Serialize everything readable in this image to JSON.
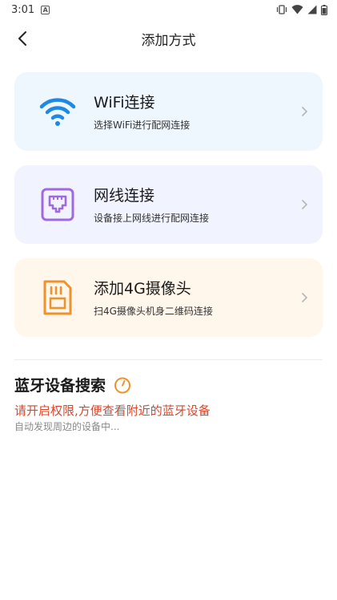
{
  "status_bar": {
    "time": "3:01",
    "notification_icon": "a-badge-icon",
    "icons": [
      "vibrate-icon",
      "wifi-signal-icon",
      "cell-signal-icon",
      "battery-icon"
    ]
  },
  "header": {
    "title": "添加方式",
    "back_icon": "back-arrow-icon"
  },
  "options": [
    {
      "title": "WiFi连接",
      "subtitle": "选择WiFi进行配网连接",
      "icon": "wifi-icon",
      "color": "#1e88e5",
      "background": "#eef6fe"
    },
    {
      "title": "网线连接",
      "subtitle": "设备接上网线进行配网连接",
      "icon": "ethernet-port-icon",
      "color": "#a169e0",
      "background": "#f1f3ff"
    },
    {
      "title": "添加4G摄像头",
      "subtitle": "扫4G摄像头机身二维码连接",
      "icon": "sim-card-icon",
      "color": "#f0922b",
      "background": "#fff7ec"
    }
  ],
  "bluetooth": {
    "title": "蓝牙设备搜索",
    "timer_icon": "timer-icon",
    "warning": "请开启权限,方便查看附近的蓝牙设备",
    "status": "自动发现周边的设备中..."
  }
}
